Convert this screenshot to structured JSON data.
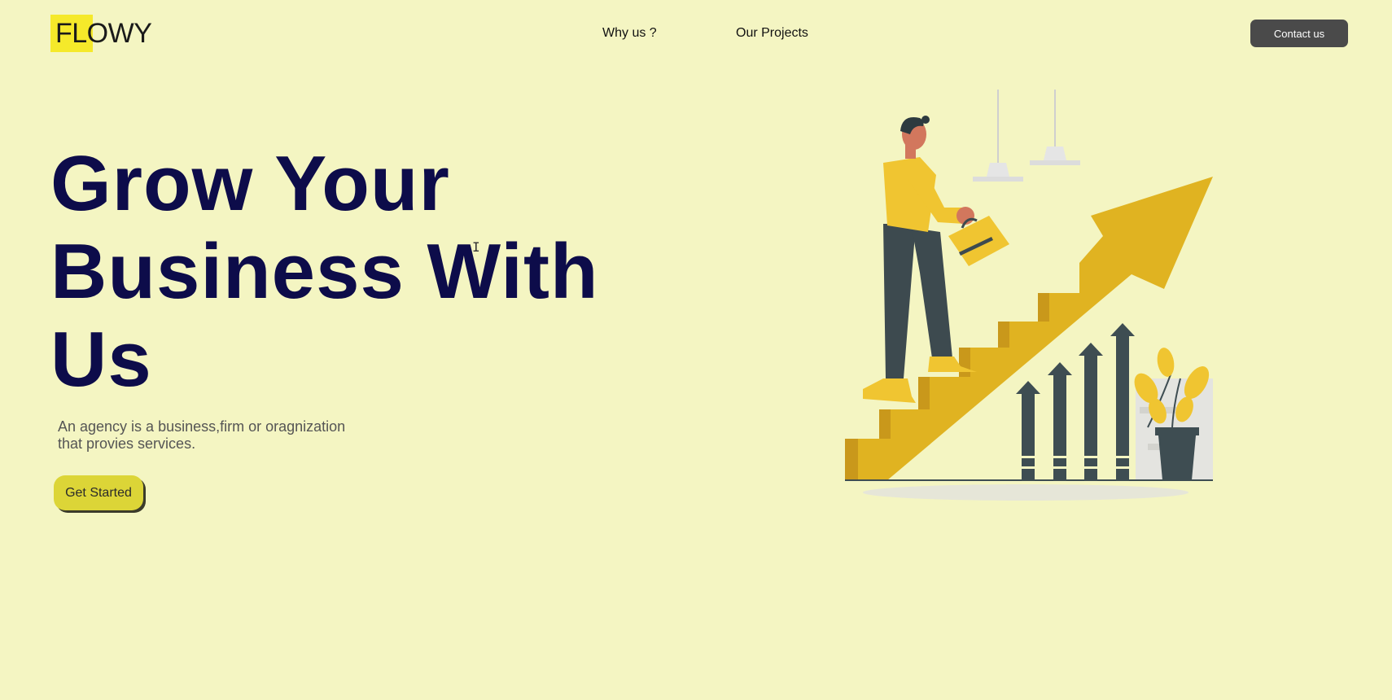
{
  "header": {
    "logo_text": "FLOWY",
    "nav": [
      {
        "label": "Why us ?"
      },
      {
        "label": "Our Projects"
      }
    ],
    "contact_label": "Contact us"
  },
  "hero": {
    "title_lines": [
      "Grow Your",
      "Business With",
      "Us"
    ],
    "description_line1": "An agency is a business,firm or oragnization",
    "description_line2": "that provies services.",
    "cta_label": "Get Started"
  },
  "illustration": {
    "icon": "business-growth-illustration"
  },
  "colors": {
    "background": "#f4f5c2",
    "title": "#0d0c4a",
    "accent_yellow": "#f5e92a",
    "cta": "#dcd537",
    "contact_button": "#4a4a4a"
  }
}
